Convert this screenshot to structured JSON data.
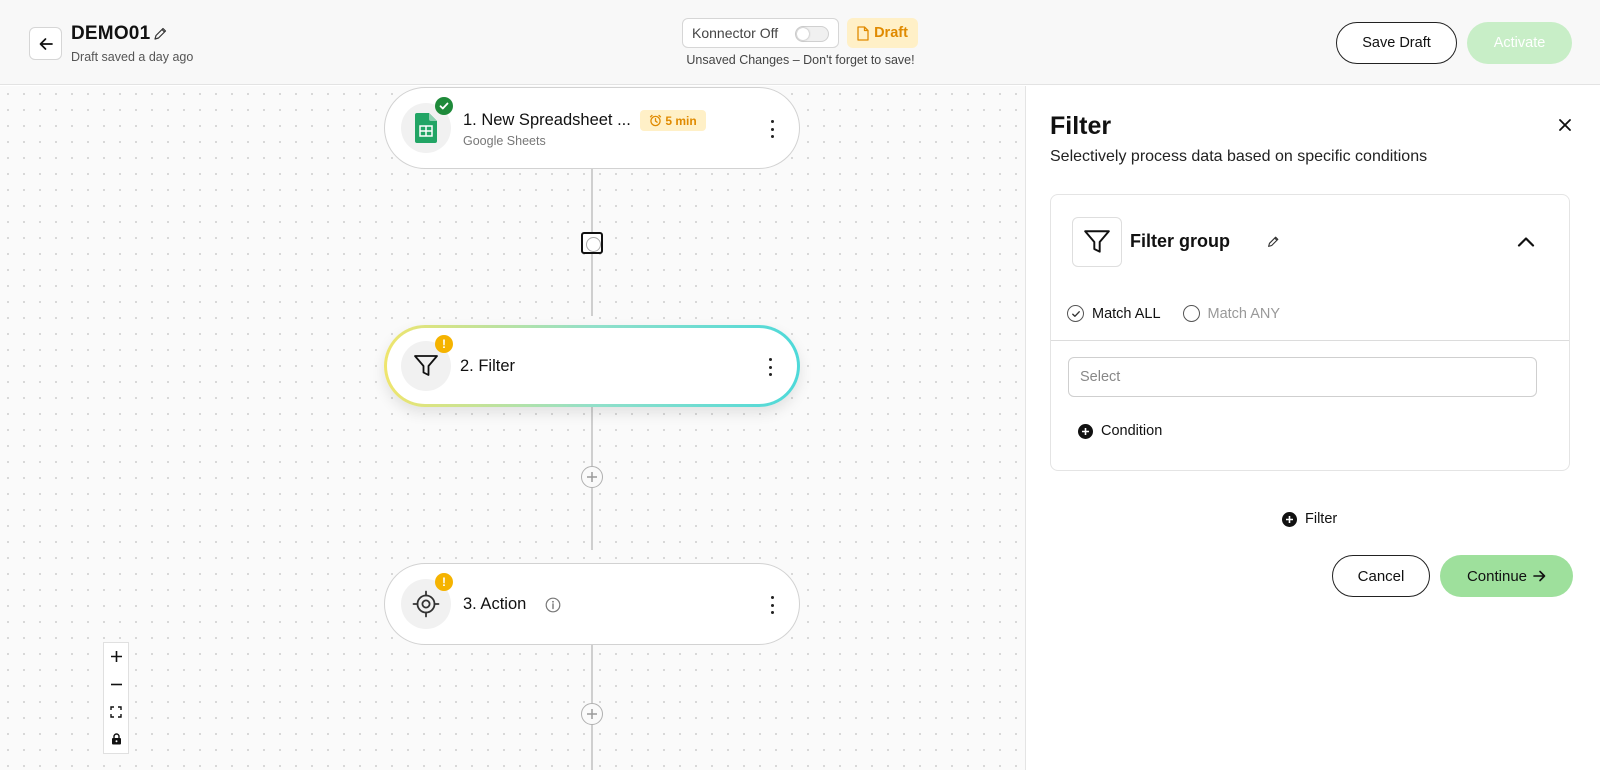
{
  "header": {
    "title": "DEMO01",
    "save_status": "Draft saved a day ago",
    "konnector_label": "Konnector Off",
    "konnector_on": false,
    "draft_badge": "Draft",
    "unsaved_note": "Unsaved Changes – Don't forget to save!",
    "save_draft_label": "Save Draft",
    "activate_label": "Activate"
  },
  "canvas": {
    "steps": [
      {
        "title": "1. New Spreadsheet ...",
        "subtitle": "Google Sheets",
        "interval": "5 min",
        "status": "ok",
        "icon": "google-sheets-icon"
      },
      {
        "title": "2. Filter",
        "status": "warning",
        "icon": "funnel-icon"
      },
      {
        "title": "3. Action",
        "status": "warning",
        "icon": "target-icon"
      }
    ],
    "warning_glyph": "!"
  },
  "panel": {
    "title": "Filter",
    "description": "Selectively process data based on specific conditions",
    "group": {
      "label": "Filter group",
      "match_all": "Match ALL",
      "match_any": "Match ANY",
      "selected_match": "ALL",
      "select_placeholder": "Select",
      "add_condition": "Condition"
    },
    "add_filter": "Filter",
    "cancel_label": "Cancel",
    "continue_label": "Continue"
  },
  "colors": {
    "accent_green": "#9ee09c",
    "activate_disabled": "#c8eec7",
    "draft_bg": "#fff0c7",
    "draft_text": "#e08a00",
    "warning": "#f5b300",
    "ok": "#1e8a3a"
  }
}
